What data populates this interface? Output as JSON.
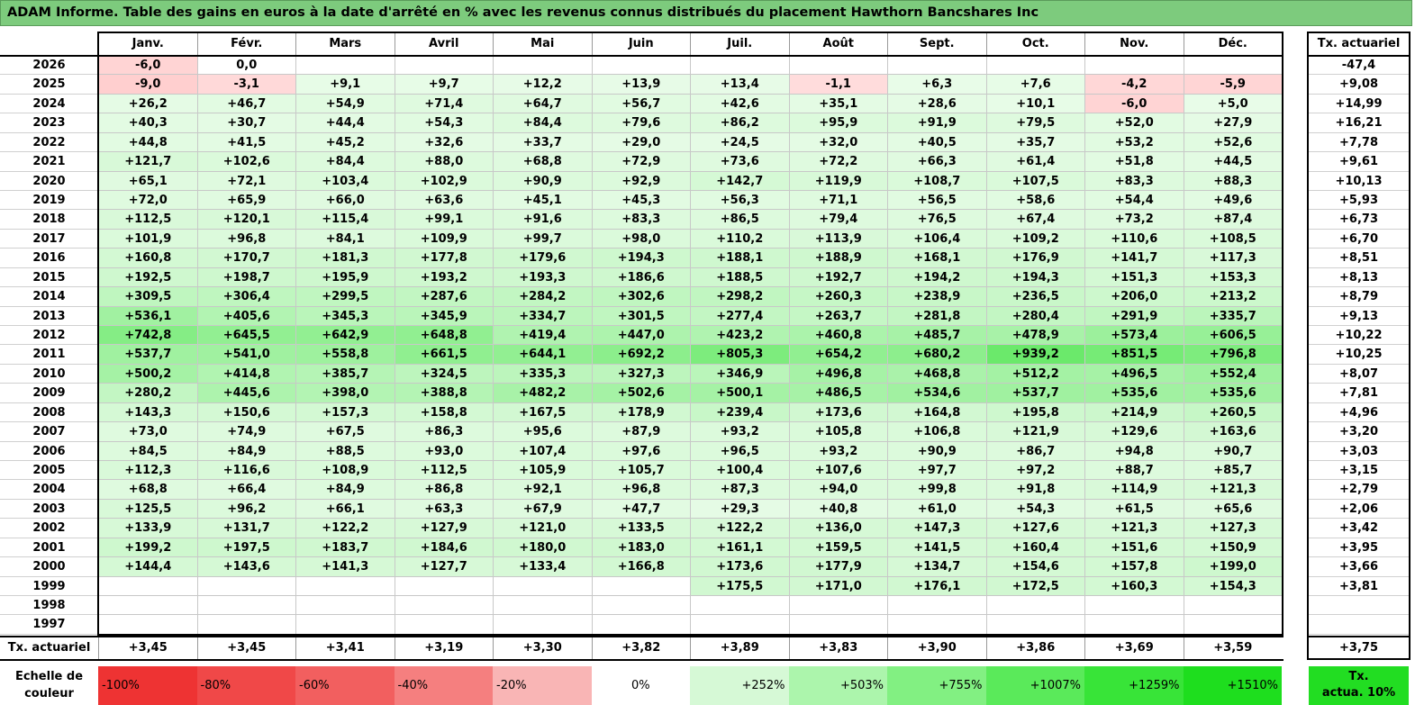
{
  "title": "ADAM Informe. Table des gains en euros à la date d'arrêté en % avec les revenus connus distribués du placement Hawthorn Bancshares Inc",
  "chart_data": {
    "type": "table",
    "columns": [
      "Janv.",
      "Févr.",
      "Mars",
      "Avril",
      "Mai",
      "Juin",
      "Juil.",
      "Août",
      "Sept.",
      "Oct.",
      "Nov.",
      "Déc."
    ],
    "annual_header": "Tx. actuariel",
    "rows": [
      {
        "year": "2026",
        "values": [
          "-6,0",
          "0,0",
          "",
          "",
          "",
          "",
          "",
          "",
          "",
          "",
          "",
          ""
        ],
        "annual": "-47,4"
      },
      {
        "year": "2025",
        "values": [
          "-9,0",
          "-3,1",
          "+9,1",
          "+9,7",
          "+12,2",
          "+13,9",
          "+13,4",
          "-1,1",
          "+6,3",
          "+7,6",
          "-4,2",
          "-5,9"
        ],
        "annual": "+9,08"
      },
      {
        "year": "2024",
        "values": [
          "+26,2",
          "+46,7",
          "+54,9",
          "+71,4",
          "+64,7",
          "+56,7",
          "+42,6",
          "+35,1",
          "+28,6",
          "+10,1",
          "-6,0",
          "+5,0"
        ],
        "annual": "+14,99"
      },
      {
        "year": "2023",
        "values": [
          "+40,3",
          "+30,7",
          "+44,4",
          "+54,3",
          "+84,4",
          "+79,6",
          "+86,2",
          "+95,9",
          "+91,9",
          "+79,5",
          "+52,0",
          "+27,9"
        ],
        "annual": "+16,21"
      },
      {
        "year": "2022",
        "values": [
          "+44,8",
          "+41,5",
          "+45,2",
          "+32,6",
          "+33,7",
          "+29,0",
          "+24,5",
          "+32,0",
          "+40,5",
          "+35,7",
          "+53,2",
          "+52,6"
        ],
        "annual": "+7,78"
      },
      {
        "year": "2021",
        "values": [
          "+121,7",
          "+102,6",
          "+84,4",
          "+88,0",
          "+68,8",
          "+72,9",
          "+73,6",
          "+72,2",
          "+66,3",
          "+61,4",
          "+51,8",
          "+44,5"
        ],
        "annual": "+9,61"
      },
      {
        "year": "2020",
        "values": [
          "+65,1",
          "+72,1",
          "+103,4",
          "+102,9",
          "+90,9",
          "+92,9",
          "+142,7",
          "+119,9",
          "+108,7",
          "+107,5",
          "+83,3",
          "+88,3"
        ],
        "annual": "+10,13"
      },
      {
        "year": "2019",
        "values": [
          "+72,0",
          "+65,9",
          "+66,0",
          "+63,6",
          "+45,1",
          "+45,3",
          "+56,3",
          "+71,1",
          "+56,5",
          "+58,6",
          "+54,4",
          "+49,6"
        ],
        "annual": "+5,93"
      },
      {
        "year": "2018",
        "values": [
          "+112,5",
          "+120,1",
          "+115,4",
          "+99,1",
          "+91,6",
          "+83,3",
          "+86,5",
          "+79,4",
          "+76,5",
          "+67,4",
          "+73,2",
          "+87,4"
        ],
        "annual": "+6,73"
      },
      {
        "year": "2017",
        "values": [
          "+101,9",
          "+96,8",
          "+84,1",
          "+109,9",
          "+99,7",
          "+98,0",
          "+110,2",
          "+113,9",
          "+106,4",
          "+109,2",
          "+110,6",
          "+108,5"
        ],
        "annual": "+6,70"
      },
      {
        "year": "2016",
        "values": [
          "+160,8",
          "+170,7",
          "+181,3",
          "+177,8",
          "+179,6",
          "+194,3",
          "+188,1",
          "+188,9",
          "+168,1",
          "+176,9",
          "+141,7",
          "+117,3"
        ],
        "annual": "+8,51"
      },
      {
        "year": "2015",
        "values": [
          "+192,5",
          "+198,7",
          "+195,9",
          "+193,2",
          "+193,3",
          "+186,6",
          "+188,5",
          "+192,7",
          "+194,2",
          "+194,3",
          "+151,3",
          "+153,3"
        ],
        "annual": "+8,13"
      },
      {
        "year": "2014",
        "values": [
          "+309,5",
          "+306,4",
          "+299,5",
          "+287,6",
          "+284,2",
          "+302,6",
          "+298,2",
          "+260,3",
          "+238,9",
          "+236,5",
          "+206,0",
          "+213,2"
        ],
        "annual": "+8,79"
      },
      {
        "year": "2013",
        "values": [
          "+536,1",
          "+405,6",
          "+345,3",
          "+345,9",
          "+334,7",
          "+301,5",
          "+277,4",
          "+263,7",
          "+281,8",
          "+280,4",
          "+291,9",
          "+335,7"
        ],
        "annual": "+9,13"
      },
      {
        "year": "2012",
        "values": [
          "+742,8",
          "+645,5",
          "+642,9",
          "+648,8",
          "+419,4",
          "+447,0",
          "+423,2",
          "+460,8",
          "+485,7",
          "+478,9",
          "+573,4",
          "+606,5"
        ],
        "annual": "+10,22"
      },
      {
        "year": "2011",
        "values": [
          "+537,7",
          "+541,0",
          "+558,8",
          "+661,5",
          "+644,1",
          "+692,2",
          "+805,3",
          "+654,2",
          "+680,2",
          "+939,2",
          "+851,5",
          "+796,8"
        ],
        "annual": "+10,25"
      },
      {
        "year": "2010",
        "values": [
          "+500,2",
          "+414,8",
          "+385,7",
          "+324,5",
          "+335,3",
          "+327,3",
          "+346,9",
          "+496,8",
          "+468,8",
          "+512,2",
          "+496,5",
          "+552,4"
        ],
        "annual": "+8,07"
      },
      {
        "year": "2009",
        "values": [
          "+280,2",
          "+445,6",
          "+398,0",
          "+388,8",
          "+482,2",
          "+502,6",
          "+500,1",
          "+486,5",
          "+534,6",
          "+537,7",
          "+535,6",
          "+535,6"
        ],
        "annual": "+7,81"
      },
      {
        "year": "2008",
        "values": [
          "+143,3",
          "+150,6",
          "+157,3",
          "+158,8",
          "+167,5",
          "+178,9",
          "+239,4",
          "+173,6",
          "+164,8",
          "+195,8",
          "+214,9",
          "+260,5"
        ],
        "annual": "+4,96"
      },
      {
        "year": "2007",
        "values": [
          "+73,0",
          "+74,9",
          "+67,5",
          "+86,3",
          "+95,6",
          "+87,9",
          "+93,2",
          "+105,8",
          "+106,8",
          "+121,9",
          "+129,6",
          "+163,6"
        ],
        "annual": "+3,20"
      },
      {
        "year": "2006",
        "values": [
          "+84,5",
          "+84,9",
          "+88,5",
          "+93,0",
          "+107,4",
          "+97,6",
          "+96,5",
          "+93,2",
          "+90,9",
          "+86,7",
          "+94,8",
          "+90,7"
        ],
        "annual": "+3,03"
      },
      {
        "year": "2005",
        "values": [
          "+112,3",
          "+116,6",
          "+108,9",
          "+112,5",
          "+105,9",
          "+105,7",
          "+100,4",
          "+107,6",
          "+97,7",
          "+97,2",
          "+88,7",
          "+85,7"
        ],
        "annual": "+3,15"
      },
      {
        "year": "2004",
        "values": [
          "+68,8",
          "+66,4",
          "+84,9",
          "+86,8",
          "+92,1",
          "+96,8",
          "+87,3",
          "+94,0",
          "+99,8",
          "+91,8",
          "+114,9",
          "+121,3"
        ],
        "annual": "+2,79"
      },
      {
        "year": "2003",
        "values": [
          "+125,5",
          "+96,2",
          "+66,1",
          "+63,3",
          "+67,9",
          "+47,7",
          "+29,3",
          "+40,8",
          "+61,0",
          "+54,3",
          "+61,5",
          "+65,6"
        ],
        "annual": "+2,06"
      },
      {
        "year": "2002",
        "values": [
          "+133,9",
          "+131,7",
          "+122,2",
          "+127,9",
          "+121,0",
          "+133,5",
          "+122,2",
          "+136,0",
          "+147,3",
          "+127,6",
          "+121,3",
          "+127,3"
        ],
        "annual": "+3,42"
      },
      {
        "year": "2001",
        "values": [
          "+199,2",
          "+197,5",
          "+183,7",
          "+184,6",
          "+180,0",
          "+183,0",
          "+161,1",
          "+159,5",
          "+141,5",
          "+160,4",
          "+151,6",
          "+150,9"
        ],
        "annual": "+3,95"
      },
      {
        "year": "2000",
        "values": [
          "+144,4",
          "+143,6",
          "+141,3",
          "+127,7",
          "+133,4",
          "+166,8",
          "+173,6",
          "+177,9",
          "+134,7",
          "+154,6",
          "+157,8",
          "+199,0"
        ],
        "annual": "+3,66"
      },
      {
        "year": "1999",
        "values": [
          "",
          "",
          "",
          "",
          "",
          "",
          "+175,5",
          "+171,0",
          "+176,1",
          "+172,5",
          "+160,3",
          "+154,3"
        ],
        "annual": "+3,81"
      },
      {
        "year": "1998",
        "values": [
          "",
          "",
          "",
          "",
          "",
          "",
          "",
          "",
          "",
          "",
          "",
          ""
        ],
        "annual": ""
      },
      {
        "year": "1997",
        "values": [
          "",
          "",
          "",
          "",
          "",
          "",
          "",
          "",
          "",
          "",
          "",
          ""
        ],
        "annual": ""
      }
    ],
    "footer": {
      "label": "Tx. actuariel",
      "values": [
        "+3,45",
        "+3,45",
        "+3,41",
        "+3,19",
        "+3,30",
        "+3,82",
        "+3,89",
        "+3,83",
        "+3,90",
        "+3,86",
        "+3,69",
        "+3,59"
      ],
      "annual": "+3,75"
    },
    "color_scale": {
      "label_line1": "Echelle de",
      "label_line2": "couleur",
      "steps": [
        {
          "label": "-100%",
          "color": "#ee3333"
        },
        {
          "label": "-80%",
          "color": "#f04848"
        },
        {
          "label": "-60%",
          "color": "#f25f5f"
        },
        {
          "label": "-40%",
          "color": "#f57f7f"
        },
        {
          "label": "-20%",
          "color": "#f9b5b5"
        },
        {
          "label": "0%",
          "color": "#ffffff"
        },
        {
          "label": "+252%",
          "color": "#d6f9d6"
        },
        {
          "label": "+503%",
          "color": "#acf5ac"
        },
        {
          "label": "+755%",
          "color": "#82f082"
        },
        {
          "label": "+1007%",
          "color": "#5aea5a"
        },
        {
          "label": "+1259%",
          "color": "#38e438"
        },
        {
          "label": "+1510%",
          "color": "#1ede1e"
        }
      ],
      "annual_line1": "Tx.",
      "annual_line2": "actua. 10%",
      "annual_color": "#22dd22"
    }
  }
}
